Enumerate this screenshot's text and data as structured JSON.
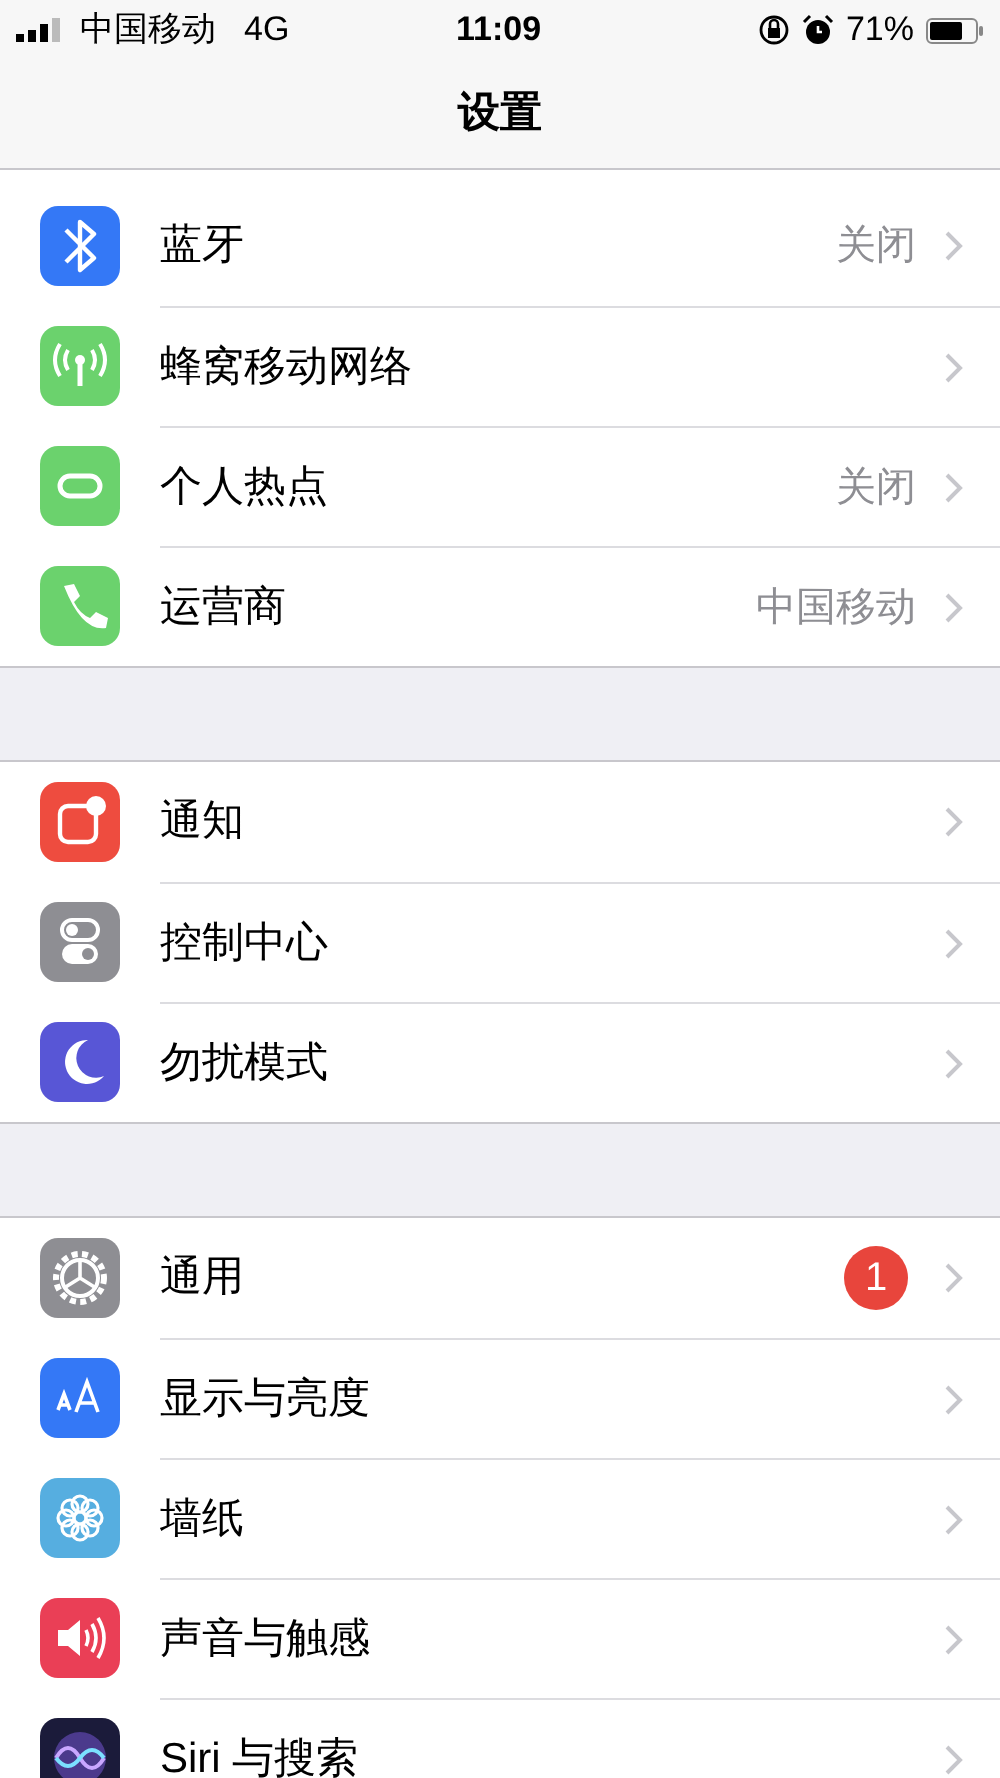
{
  "status_bar": {
    "carrier": "中国移动",
    "network": "4G",
    "time": "11:09",
    "battery": "71%"
  },
  "nav": {
    "title": "设置"
  },
  "groups": [
    {
      "items": [
        {
          "kind": "bluetooth",
          "label": "蓝牙",
          "value": "关闭"
        },
        {
          "kind": "cellular",
          "label": "蜂窝移动网络"
        },
        {
          "kind": "hotspot",
          "label": "个人热点",
          "value": "关闭"
        },
        {
          "kind": "phone",
          "label": "运营商",
          "value": "中国移动"
        }
      ]
    },
    {
      "items": [
        {
          "kind": "notifications",
          "label": "通知"
        },
        {
          "kind": "control",
          "label": "控制中心"
        },
        {
          "kind": "moon",
          "label": "勿扰模式"
        }
      ]
    },
    {
      "items": [
        {
          "kind": "gear",
          "label": "通用",
          "badge": "1"
        },
        {
          "kind": "display",
          "label": "显示与亮度"
        },
        {
          "kind": "wallpaper",
          "label": "墙纸"
        },
        {
          "kind": "sound",
          "label": "声音与触感"
        },
        {
          "kind": "siri",
          "label": "Siri 与搜索"
        }
      ]
    }
  ]
}
